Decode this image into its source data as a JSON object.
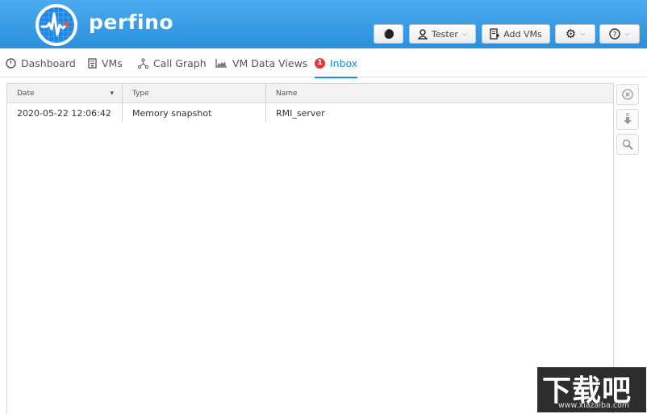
{
  "app": {
    "brand": "perfino",
    "accent_color": "#1e88e5"
  },
  "header": {
    "theme_button_icon": "theme-toggle-icon",
    "user_label": "Tester",
    "add_vms_label": "Add VMs",
    "settings_icon": "gear-icon",
    "help_icon": "help-icon"
  },
  "tabs": [
    {
      "label": "Dashboard",
      "icon": "dashboard-icon"
    },
    {
      "label": "VMs",
      "icon": "server-icon"
    },
    {
      "label": "Call Graph",
      "icon": "call-graph-icon"
    },
    {
      "label": "VM Data Views",
      "icon": "chart-icon"
    },
    {
      "label": "Inbox",
      "icon": "inbox-badge",
      "badge": "1",
      "active": true
    }
  ],
  "table": {
    "columns": [
      "Date",
      "Type",
      "Name"
    ],
    "sort_indicator": "▾",
    "rows": [
      {
        "date": "2020-05-22 12:06:42",
        "type": "Memory snapshot",
        "name": "RMI_server"
      }
    ]
  },
  "side_actions": [
    {
      "name": "delete",
      "icon": "close-circle-icon",
      "glyph": "⊗"
    },
    {
      "name": "download",
      "icon": "download-icon",
      "glyph": "⇓"
    },
    {
      "name": "view",
      "icon": "search-icon",
      "glyph": "⚲"
    }
  ],
  "watermark": {
    "text": "下载吧",
    "url": "www.xiazaiba.com"
  }
}
